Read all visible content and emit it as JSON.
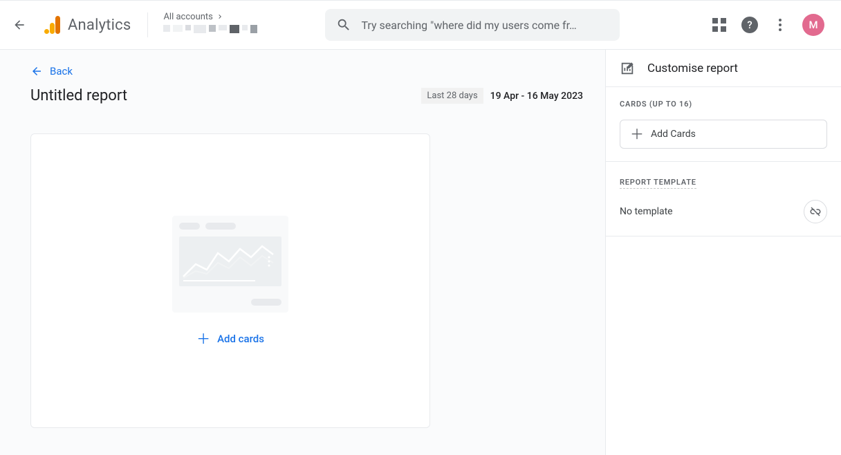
{
  "header": {
    "brand": "Analytics",
    "account_label": "All accounts",
    "search_placeholder": "Try searching \"where did my users come fr…",
    "avatar_initial": "M"
  },
  "main": {
    "back_label": "Back",
    "report_title": "Untitled report",
    "date_preset": "Last 28 days",
    "date_range": "19 Apr - 16 May 2023",
    "add_cards_label": "Add cards"
  },
  "side": {
    "title": "Customise report",
    "cards_section_label": "CARDS (UP TO 16)",
    "add_cards_label": "Add Cards",
    "template_section_label": "REPORT TEMPLATE",
    "template_value": "No template"
  }
}
